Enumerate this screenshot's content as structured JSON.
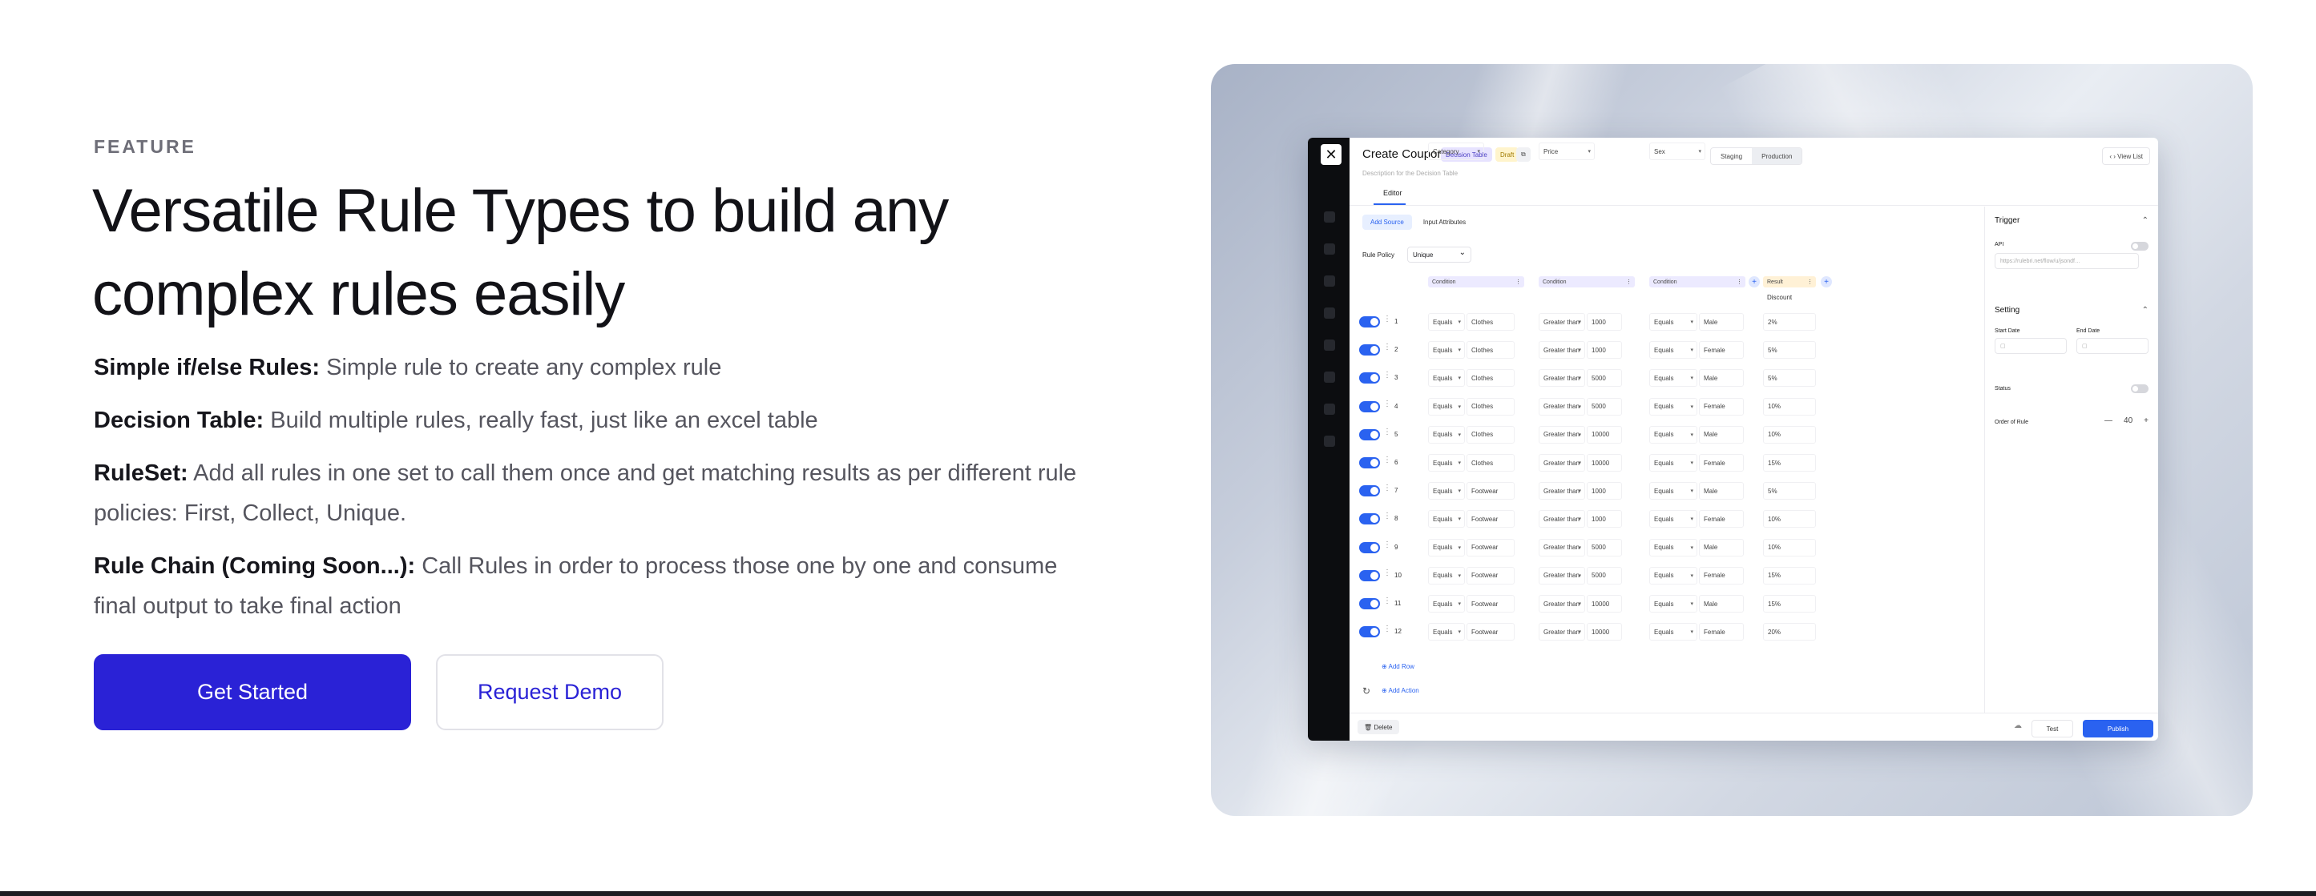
{
  "eyebrow": "FEATURE",
  "headline": "Versatile Rule Types to build any complex rules easily",
  "features": [
    {
      "title": "Simple if/else Rules:",
      "text": " Simple rule to create any complex rule"
    },
    {
      "title": "Decision Table:",
      "text": " Build multiple rules, really fast, just like an excel table"
    },
    {
      "title": "RuleSet:",
      "text": " Add all rules in one set to call them once and get matching results as per different rule policies: First, Collect, Unique."
    },
    {
      "title": "Rule Chain (Coming Soon...):",
      "text": " Call Rules in order to process those one by one and consume final output to take final action"
    }
  ],
  "buttons": {
    "primary": "Get Started",
    "secondary": "Request Demo"
  },
  "app": {
    "close": "✕",
    "title": "Create Coupon",
    "badge_type": "Decision Table",
    "badge_status": "Draft",
    "copy_icon": "⧉",
    "description": "Description for the Decision Table",
    "env_tabs": [
      "Staging",
      "Production"
    ],
    "view_list": "‹ › View List",
    "tab_editor": "Editor",
    "source_tabs": [
      "Add Source",
      "Input Attributes"
    ],
    "rule_policy_label": "Rule Policy",
    "rule_policy_value": "Unique",
    "columns": [
      {
        "head": "Condition",
        "attr": "Category"
      },
      {
        "head": "Condition",
        "attr": "Price"
      },
      {
        "head": "Condition",
        "attr": "Sex"
      },
      {
        "head": "Result",
        "attr": "Discount"
      }
    ],
    "rows": [
      {
        "n": "1",
        "op1": "Equals",
        "cat": "Clothes",
        "op2": "Greater than",
        "price": "1000",
        "op3": "Equals",
        "sex": "Male",
        "disc": "2%"
      },
      {
        "n": "2",
        "op1": "Equals",
        "cat": "Clothes",
        "op2": "Greater than",
        "price": "1000",
        "op3": "Equals",
        "sex": "Female",
        "disc": "5%"
      },
      {
        "n": "3",
        "op1": "Equals",
        "cat": "Clothes",
        "op2": "Greater than",
        "price": "5000",
        "op3": "Equals",
        "sex": "Male",
        "disc": "5%"
      },
      {
        "n": "4",
        "op1": "Equals",
        "cat": "Clothes",
        "op2": "Greater than",
        "price": "5000",
        "op3": "Equals",
        "sex": "Female",
        "disc": "10%"
      },
      {
        "n": "5",
        "op1": "Equals",
        "cat": "Clothes",
        "op2": "Greater than",
        "price": "10000",
        "op3": "Equals",
        "sex": "Male",
        "disc": "10%"
      },
      {
        "n": "6",
        "op1": "Equals",
        "cat": "Clothes",
        "op2": "Greater than",
        "price": "10000",
        "op3": "Equals",
        "sex": "Female",
        "disc": "15%"
      },
      {
        "n": "7",
        "op1": "Equals",
        "cat": "Footwear",
        "op2": "Greater than",
        "price": "1000",
        "op3": "Equals",
        "sex": "Male",
        "disc": "5%"
      },
      {
        "n": "8",
        "op1": "Equals",
        "cat": "Footwear",
        "op2": "Greater than",
        "price": "1000",
        "op3": "Equals",
        "sex": "Female",
        "disc": "10%"
      },
      {
        "n": "9",
        "op1": "Equals",
        "cat": "Footwear",
        "op2": "Greater than",
        "price": "5000",
        "op3": "Equals",
        "sex": "Male",
        "disc": "10%"
      },
      {
        "n": "10",
        "op1": "Equals",
        "cat": "Footwear",
        "op2": "Greater than",
        "price": "5000",
        "op3": "Equals",
        "sex": "Female",
        "disc": "15%"
      },
      {
        "n": "11",
        "op1": "Equals",
        "cat": "Footwear",
        "op2": "Greater than",
        "price": "10000",
        "op3": "Equals",
        "sex": "Male",
        "disc": "15%"
      },
      {
        "n": "12",
        "op1": "Equals",
        "cat": "Footwear",
        "op2": "Greater than",
        "price": "10000",
        "op3": "Equals",
        "sex": "Female",
        "disc": "20%"
      }
    ],
    "add_row": "⊕ Add Row",
    "add_action": "⊕ Add Action",
    "refresh_icon": "↻",
    "panel": {
      "trigger": "Trigger",
      "api_label": "API",
      "api_value": "https://rulebri.net/flow/u/jsondf…",
      "setting": "Setting",
      "start_date": "Start Date",
      "end_date": "End Date",
      "status": "Status",
      "order_label": "Order of Rule",
      "order_value": "40",
      "minus": "—",
      "plus": "+"
    },
    "footer": {
      "delete": "🗑 Delete",
      "test": "Test",
      "publish": "Publish",
      "cloud_icon": "☁"
    }
  }
}
